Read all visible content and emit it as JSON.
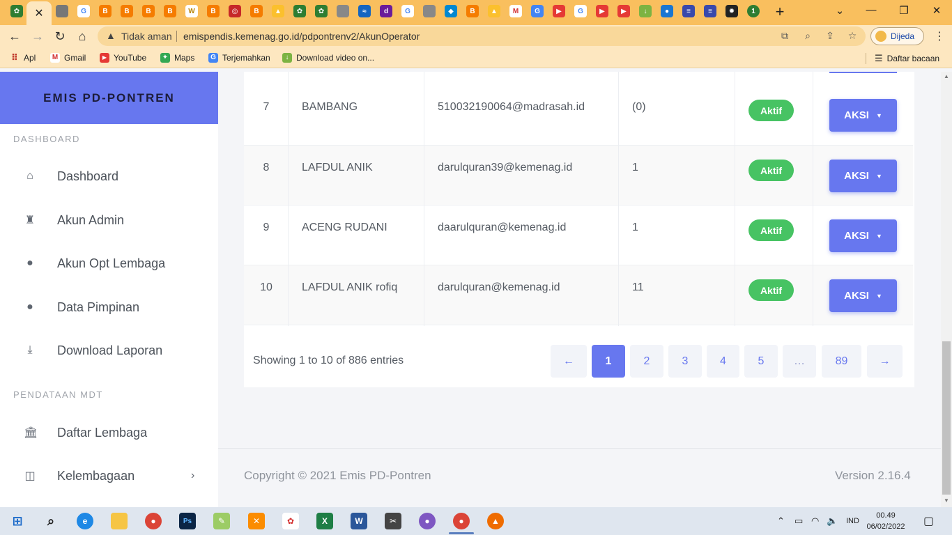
{
  "browser": {
    "active_tab_close": "✕",
    "new_tab": "+",
    "security_label": "Tidak aman",
    "url": "emispendis.kemenag.go.id/pdpontrenv2/AkunOperator",
    "profile_name": "Dijeda",
    "bookmarks": [
      "Apl",
      "Gmail",
      "YouTube",
      "Maps",
      "Terjemahkan",
      "Download video on..."
    ],
    "reading_list": "Daftar bacaan"
  },
  "sidebar": {
    "brand": "EMIS PD-PONTREN",
    "section_dashboard": "DASHBOARD",
    "section_mdt": "PENDATAAN MDT",
    "items": [
      {
        "label": "Dashboard",
        "icon": "home-icon"
      },
      {
        "label": "Akun Admin",
        "icon": "user-tie-icon"
      },
      {
        "label": "Akun Opt Lembaga",
        "icon": "user-icon"
      },
      {
        "label": "Data Pimpinan",
        "icon": "user-icon"
      },
      {
        "label": "Download Laporan",
        "icon": "download-icon"
      },
      {
        "label": "Daftar Lembaga",
        "icon": "institution-icon"
      },
      {
        "label": "Kelembagaan",
        "icon": "columns-icon"
      }
    ]
  },
  "table": {
    "rows": [
      {
        "no": "7",
        "name": "BAMBANG",
        "email": "510032190064@madrasah.id",
        "count": "(0)",
        "status": "Aktif",
        "action": "AKSI"
      },
      {
        "no": "8",
        "name": "LAFDUL ANIK",
        "email": "darulquran39@kemenag.id",
        "count": "1",
        "status": "Aktif",
        "action": "AKSI"
      },
      {
        "no": "9",
        "name": "ACENG RUDANI",
        "email": "daarulquran@kemenag.id",
        "count": "1",
        "status": "Aktif",
        "action": "AKSI"
      },
      {
        "no": "10",
        "name": "LAFDUL ANIK rofiq",
        "email": "darulquran@kemenag.id",
        "count": "11",
        "status": "Aktif",
        "action": "AKSI"
      }
    ]
  },
  "pagination": {
    "info": "Showing 1 to 10 of 886 entries",
    "prev": "←",
    "pages": [
      "1",
      "2",
      "3",
      "4",
      "5",
      "…",
      "89"
    ],
    "next": "→",
    "current": "1"
  },
  "footer": {
    "copyright": "Copyright © 2021 Emis PD-Pontren",
    "version": "Version 2.16.4"
  },
  "taskbar": {
    "language": "IND",
    "time": "00.49",
    "date": "06/02/2022"
  },
  "colors": {
    "primary": "#6777ef",
    "success": "#47c363",
    "tabstrip": "#f9bf5e",
    "toolbar": "#fde7c0"
  }
}
